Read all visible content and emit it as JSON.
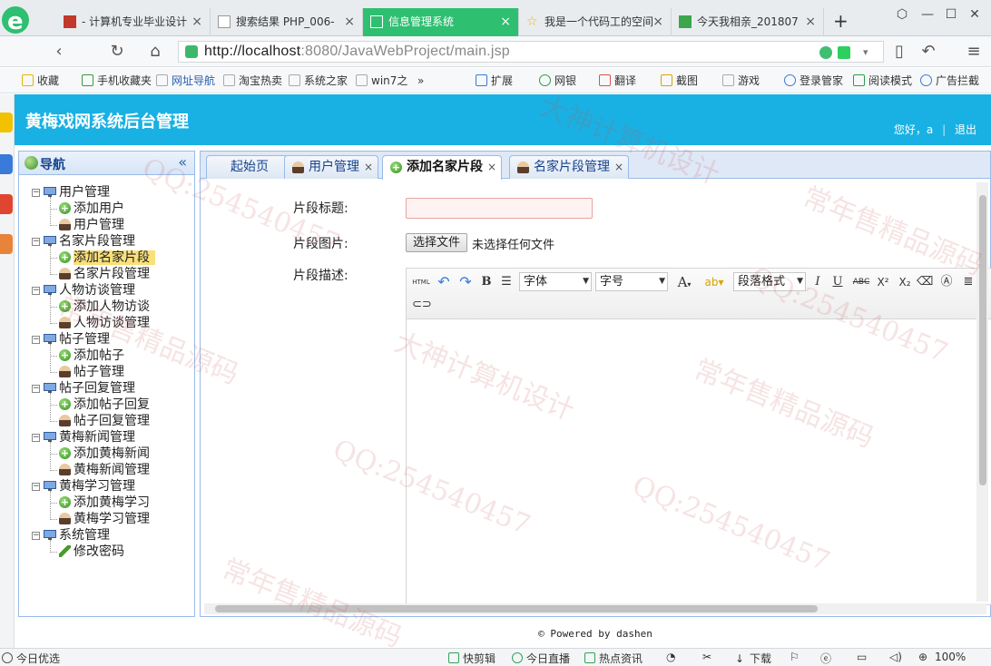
{
  "browser": {
    "tabs": [
      {
        "label": "- 计算机专业毕业设计",
        "close": "×"
      },
      {
        "label": "搜索结果 PHP_006-",
        "close": "×"
      },
      {
        "label": "信息管理系统",
        "close": "×"
      },
      {
        "label": "我是一个代码工的空间",
        "close": "×"
      },
      {
        "label": "今天我相亲_201807",
        "close": "×"
      }
    ],
    "new_tab": "+",
    "url_host": "http://localhost",
    "url_rest": ":8080/JavaWebProject/main.jsp",
    "bookmarks": [
      "收藏",
      "手机收藏夹",
      "网址导航",
      "淘宝热卖",
      "系统之家",
      "win7之",
      "扩展",
      "网银",
      "翻译",
      "截图",
      "游戏",
      "登录管家",
      "阅读模式",
      "广告拦截"
    ],
    "status_left": "今日优选",
    "status_items": [
      "快剪辑",
      "今日直播",
      "热点资讯",
      "下载"
    ],
    "zoom": "100%"
  },
  "header": {
    "title": "黄梅戏网系统后台管理",
    "greeting": "您好，a",
    "logout": "退出"
  },
  "nav": {
    "title": "导航",
    "collapse": "«",
    "groups": [
      {
        "label": "用户管理",
        "items": [
          "添加用户",
          "用户管理"
        ]
      },
      {
        "label": "名家片段管理",
        "items": [
          "添加名家片段",
          "名家片段管理"
        ]
      },
      {
        "label": "人物访谈管理",
        "items": [
          "添加人物访谈",
          "人物访谈管理"
        ]
      },
      {
        "label": "帖子管理",
        "items": [
          "添加帖子",
          "帖子管理"
        ]
      },
      {
        "label": "帖子回复管理",
        "items": [
          "添加帖子回复",
          "帖子回复管理"
        ]
      },
      {
        "label": "黄梅新闻管理",
        "items": [
          "添加黄梅新闻",
          "黄梅新闻管理"
        ]
      },
      {
        "label": "黄梅学习管理",
        "items": [
          "添加黄梅学习",
          "黄梅学习管理"
        ]
      },
      {
        "label": "系统管理",
        "items": [
          "修改密码"
        ]
      }
    ]
  },
  "content_tabs": [
    {
      "label": "起始页",
      "close": ""
    },
    {
      "label": "用户管理",
      "close": "×"
    },
    {
      "label": "添加名家片段",
      "close": "×"
    },
    {
      "label": "名家片段管理",
      "close": "×"
    }
  ],
  "form": {
    "title_label": "片段标题:",
    "title_value": "",
    "image_label": "片段图片:",
    "file_button": "选择文件",
    "file_status": "未选择任何文件",
    "desc_label": "片段描述:",
    "editor": {
      "html": "HTML",
      "bold": "B",
      "font": "字体",
      "size": "字号",
      "paragraph": "段落格式",
      "font_color": "A",
      "italic": "I",
      "underline": "U",
      "strike": "ABC",
      "sup": "X²",
      "sub": "X₂"
    }
  },
  "footer": "© Powered by dashen",
  "watermark": {
    "lines": [
      "QQ:254540457",
      "大神计算机设计",
      "常年售精品源码"
    ]
  },
  "colors": {
    "header_bg": "#19b1e3",
    "active_browser_tab": "#2fbf71",
    "selected_node": "#f9e07a"
  }
}
